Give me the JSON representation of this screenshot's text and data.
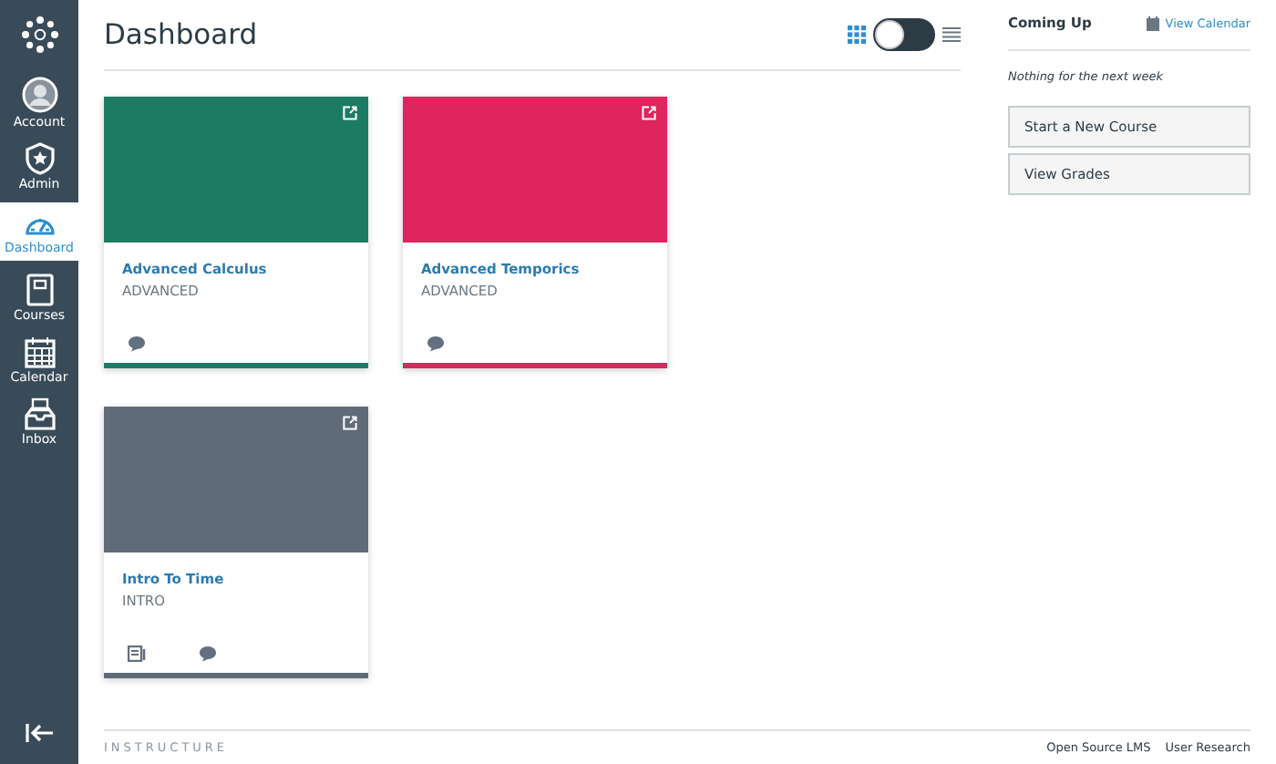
{
  "sidebar": {
    "items": [
      {
        "label": "Account",
        "kind": "account",
        "selected": false
      },
      {
        "label": "Admin",
        "kind": "admin",
        "selected": false
      },
      {
        "label": "Dashboard",
        "kind": "dashboard",
        "selected": true
      },
      {
        "label": "Courses",
        "kind": "courses",
        "selected": false
      },
      {
        "label": "Calendar",
        "kind": "calendar",
        "selected": false
      },
      {
        "label": "Inbox",
        "kind": "inbox",
        "selected": false
      }
    ]
  },
  "header": {
    "title": "Dashboard",
    "list_view": false
  },
  "cards": [
    {
      "title": "Advanced Calculus",
      "code": "ADVANCED",
      "color": "#1e7b63",
      "icons": [
        {
          "kind": "discussion"
        }
      ]
    },
    {
      "title": "Advanced Temporics",
      "code": "ADVANCED",
      "color": "#e0245e",
      "icons": [
        {
          "kind": "discussion"
        }
      ]
    },
    {
      "title": "Intro To Time",
      "code": "INTRO",
      "color": "#5f6b78",
      "icons": [
        {
          "kind": "announcement"
        },
        {
          "kind": "discussion"
        }
      ]
    }
  ],
  "coming_up": {
    "title": "Coming Up",
    "link": "View Calendar",
    "empty": "Nothing for the next week"
  },
  "buttons": [
    "Start a New Course",
    "View Grades"
  ],
  "footer": {
    "brand": "INSTRUCTURE",
    "links": [
      "Open Source LMS",
      "User Research"
    ]
  }
}
